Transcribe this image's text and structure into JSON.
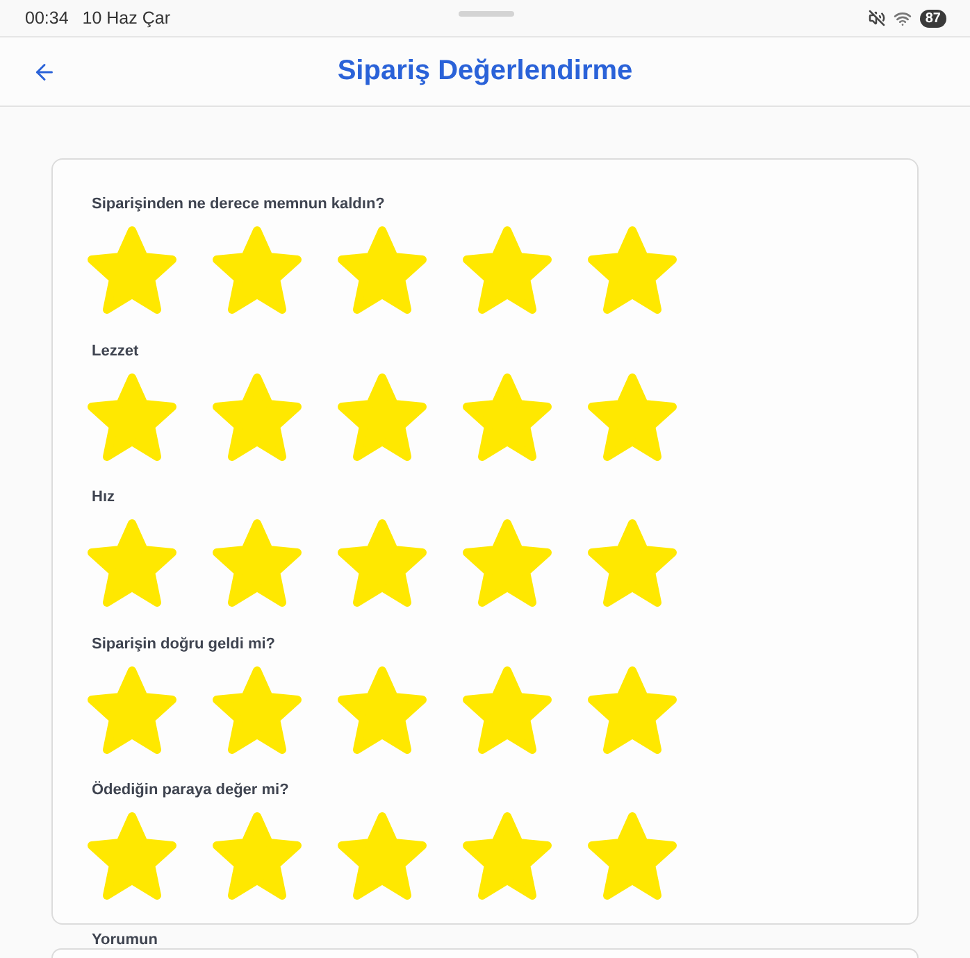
{
  "status_bar": {
    "time": "00:34",
    "date": "10 Haz Çar",
    "battery": "87"
  },
  "header": {
    "title": "Sipariş Değerlendirme"
  },
  "ratings": [
    {
      "question": "Siparişinden ne derece memnun kaldın?",
      "stars": 5
    },
    {
      "question": "Lezzet",
      "stars": 5
    },
    {
      "question": "Hız",
      "stars": 5
    },
    {
      "question": "Siparişin doğru geldi mi?",
      "stars": 5
    },
    {
      "question": "Ödediğin paraya değer mi?",
      "stars": 5
    }
  ],
  "comment": {
    "label": "Yorumun"
  }
}
